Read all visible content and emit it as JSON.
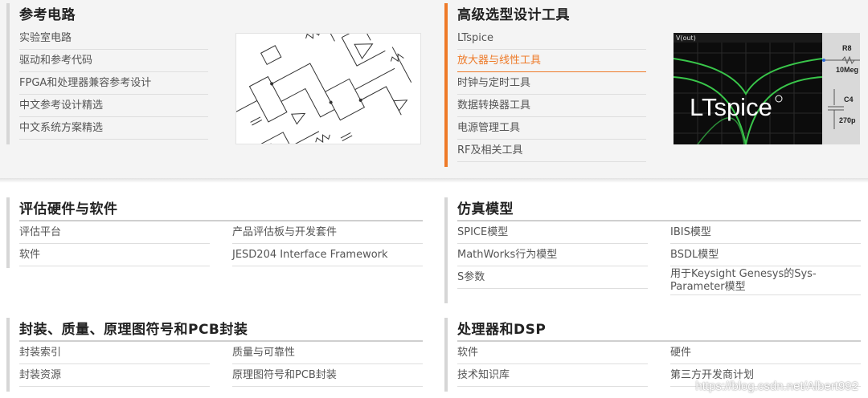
{
  "reference_circuits": {
    "title": "参考电路",
    "items": [
      "实验室电路",
      "驱动和参考代码",
      "FPGA和处理器兼容参考设计",
      "中文参考设计精选",
      "中文系统方案精选"
    ]
  },
  "design_tools": {
    "title": "高级选型设计工具",
    "items": [
      "LTspice",
      "放大器与线性工具",
      "时钟与定时工具",
      "数据转换器工具",
      "电源管理工具",
      "RF及相关工具"
    ],
    "active_index": 1,
    "image": {
      "waveform_label": "V(out)",
      "logo": "LTspice",
      "r8": "R8",
      "r8_value": "10Meg",
      "c4": "C4",
      "c4_value": "270p"
    }
  },
  "eval_hw_sw": {
    "title": "评估硬件与软件",
    "col1": [
      "评估平台",
      "软件"
    ],
    "col2": [
      "产品评估板与开发套件",
      "JESD204 Interface Framework"
    ]
  },
  "sim_models": {
    "title": "仿真模型",
    "col1": [
      "SPICE模型",
      "MathWorks行为模型",
      "S参数"
    ],
    "col2": [
      "IBIS模型",
      "BSDL模型",
      "用于Keysight Genesys的Sys-Parameter模型"
    ]
  },
  "packaging": {
    "title": "封装、质量、原理图符号和PCB封装",
    "col1": [
      "封装索引",
      "封装资源"
    ],
    "col2": [
      "质量与可靠性",
      "原理图符号和PCB封装"
    ]
  },
  "processors": {
    "title": "处理器和DSP",
    "col1": [
      "软件",
      "技术知识库"
    ],
    "col2": [
      "硬件",
      "第三方开发商计划"
    ]
  },
  "watermark": "https://blog.csdn.net/Albert992",
  "colors": {
    "accent": "#ee7a28",
    "band": "#f4f4f4",
    "title": "#222222",
    "link": "#555555"
  }
}
